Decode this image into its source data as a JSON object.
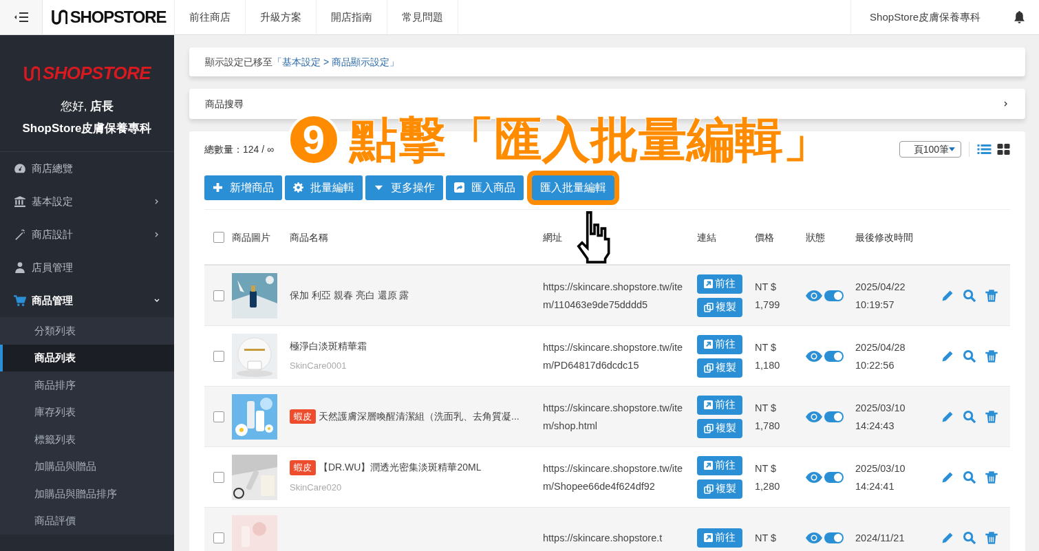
{
  "topbar": {
    "logo": "SHOPSTORE",
    "nav": [
      "前往商店",
      "升級方案",
      "開店指南",
      "常見問題"
    ],
    "store_name": "ShopStore皮膚保養專科"
  },
  "sidebar": {
    "logo": "SHOPSTORE",
    "greeting": "您好, **店長**",
    "store_name": "ShopStore皮膚保養專科",
    "items": [
      {
        "label": "商店總覽",
        "selected": false
      },
      {
        "label": "基本設定",
        "expanded": false,
        "selected": false
      },
      {
        "label": "商店設計",
        "expanded": false,
        "selected": false
      },
      {
        "label": "店員管理",
        "selected": false
      },
      {
        "label": "商品管理",
        "expanded": true,
        "selected": true,
        "children": [
          {
            "label": "分類列表",
            "selected": false
          },
          {
            "label": "商品列表",
            "selected": true
          },
          {
            "label": "商品排序",
            "selected": false
          },
          {
            "label": "庫存列表",
            "selected": false
          },
          {
            "label": "標籤列表",
            "selected": false
          },
          {
            "label": "加購品與贈品",
            "selected": false
          },
          {
            "label": "加購品與贈品排序",
            "selected": false
          },
          {
            "label": "商品評價",
            "selected": false
          }
        ]
      }
    ]
  },
  "notice": {
    "text": "顯示設定已移至",
    "link": "「基本設定 > 商品顯示設定」"
  },
  "search_panel": {
    "title": "商品搜尋"
  },
  "stats": {
    "text": "總數量：124 / ∞",
    "per_page": "頁100筆"
  },
  "toolbar": [
    {
      "label": "新增商品",
      "highlighted": false
    },
    {
      "label": "批量編輯",
      "highlighted": false
    },
    {
      "label": "更多操作",
      "highlighted": false
    },
    {
      "label": "匯入商品",
      "highlighted": false
    },
    {
      "label": "匯入批量編輯",
      "highlighted": true
    }
  ],
  "table": {
    "select_all_checked": false,
    "columns": [
      "商品圖片",
      "商品名稱",
      "網址",
      "連結",
      "價格",
      "狀態",
      "最後修改時間"
    ],
    "rows": [
      {
        "checked": false,
        "name": "保加 利亞 親春 亮白 還原 露",
        "tag": "",
        "sku": "",
        "url": "https://skincare.shopstore.tw/item/110463e9de75dddd5",
        "go": "前往",
        "copy": "複製",
        "price": "NT $ 1,799",
        "visible": true,
        "enabled": true,
        "date": "2025/04/22 10:19:57"
      },
      {
        "checked": false,
        "name": "極淨白淡斑精華霜",
        "tag": "",
        "sku": "SkinCare0001",
        "url": "https://skincare.shopstore.tw/item/PD64817d6dcdc15",
        "go": "前往",
        "copy": "複製",
        "price": "NT $ 1,180",
        "visible": true,
        "enabled": true,
        "date": "2025/04/28 10:22:56"
      },
      {
        "checked": false,
        "name": "天然護膚深層喚醒清潔組（洗面乳、去角質凝...",
        "tag": "蝦皮",
        "sku": "",
        "url": "https://skincare.shopstore.tw/item/shop.html",
        "go": "前往",
        "copy": "複製",
        "price": "NT $ 1,780",
        "visible": true,
        "enabled": true,
        "date": "2025/03/10 14:24:43"
      },
      {
        "checked": false,
        "name": "【DR.WU】潤透光密集淡斑精華20ML",
        "tag": "蝦皮",
        "sku": "SkinCare020",
        "url": "https://skincare.shopstore.tw/item/Shopee66de4f624df92",
        "go": "前往",
        "copy": "複製",
        "price": "NT $ 1,280",
        "visible": true,
        "enabled": true,
        "date": "2025/03/10 14:24:41"
      },
      {
        "checked": false,
        "name": "",
        "tag": "",
        "sku": "",
        "url": "https://skincare.shopstore.t",
        "go": "前往",
        "copy": "",
        "price": "NT $",
        "visible": true,
        "enabled": true,
        "date": "2024/11/21"
      }
    ]
  },
  "annotation": {
    "step": "9",
    "text": "點擊「匯入批量編輯」"
  }
}
